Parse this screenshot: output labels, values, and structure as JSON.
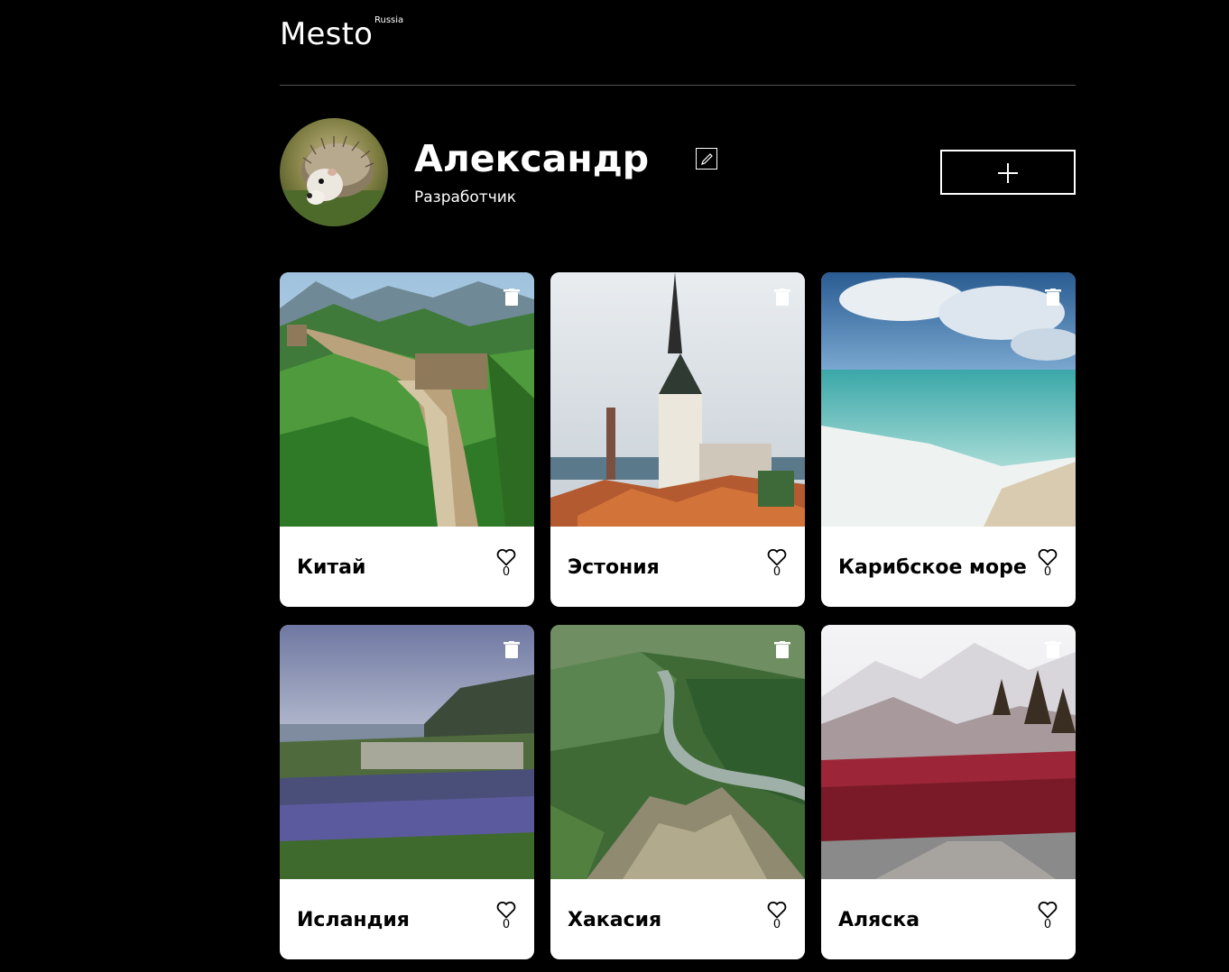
{
  "header": {
    "logo": "Mesto",
    "logo_sup": "Russia"
  },
  "profile": {
    "name": "Александр",
    "about": "Разработчик"
  },
  "cards": [
    {
      "title": "Китай",
      "likes": "0"
    },
    {
      "title": "Эстония",
      "likes": "0"
    },
    {
      "title": "Карибское море",
      "likes": "0"
    },
    {
      "title": "Исландия",
      "likes": "0"
    },
    {
      "title": "Хакасия",
      "likes": "0"
    },
    {
      "title": "Аляска",
      "likes": "0"
    }
  ],
  "icons": {
    "edit": "pencil-icon",
    "add": "plus-icon",
    "delete": "trash-icon",
    "like": "heart-icon"
  }
}
